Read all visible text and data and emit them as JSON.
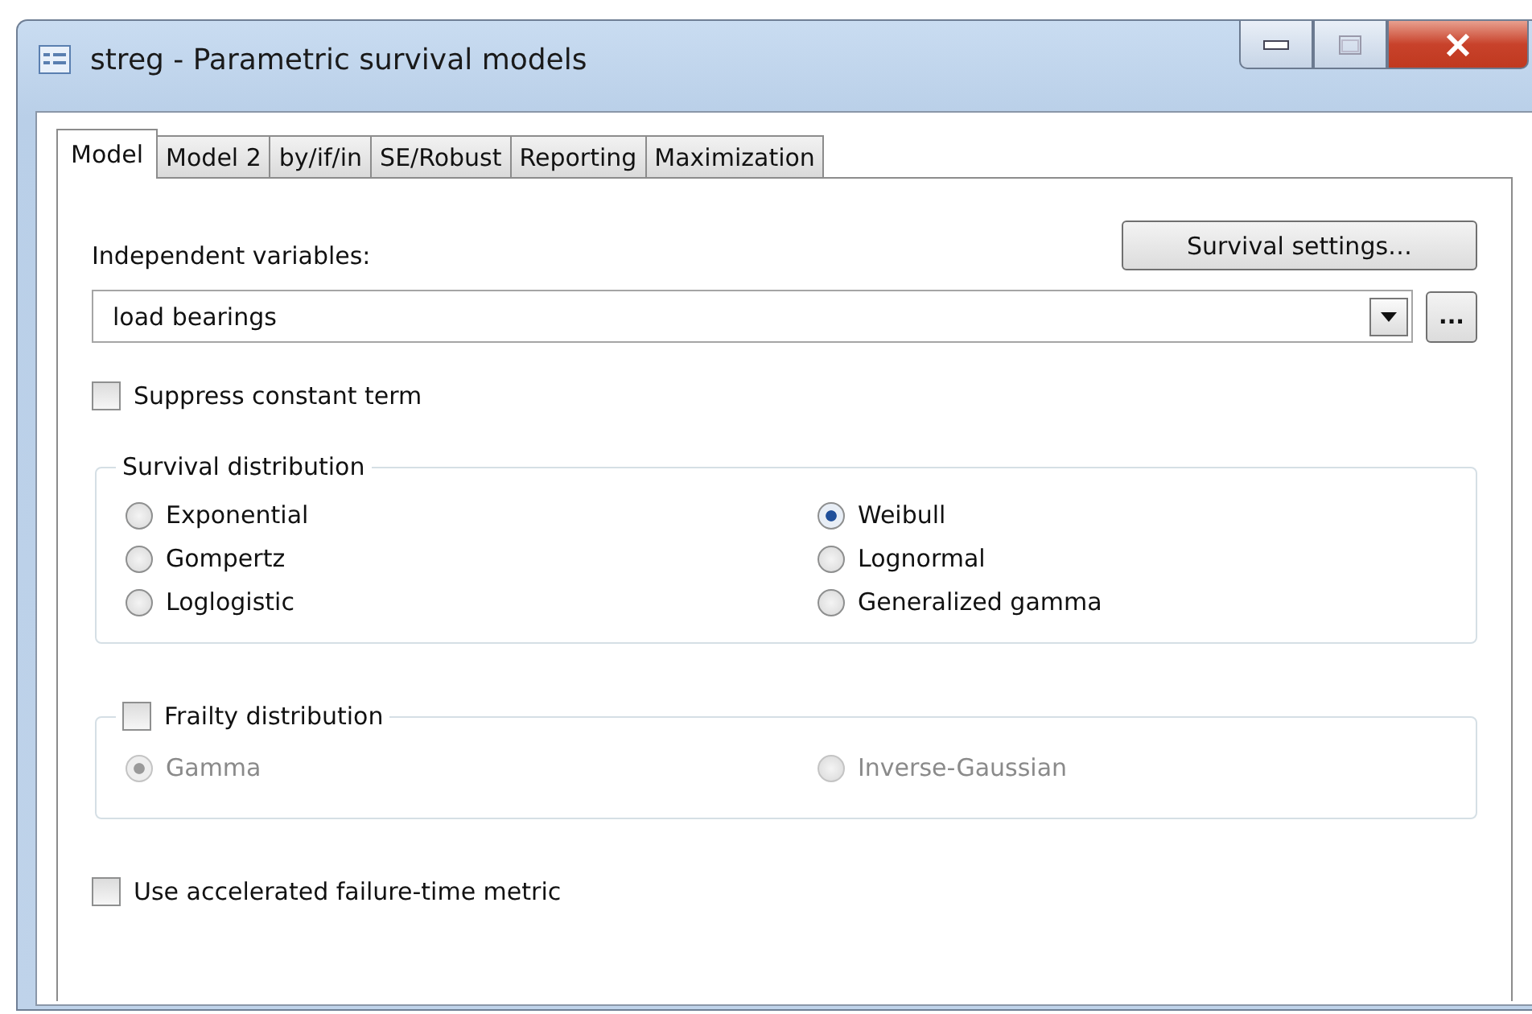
{
  "window": {
    "title": "streg - Parametric survival models"
  },
  "tabs": [
    {
      "label": "Model",
      "selected": true
    },
    {
      "label": "Model 2",
      "selected": false
    },
    {
      "label": "by/if/in",
      "selected": false
    },
    {
      "label": "SE/Robust",
      "selected": false
    },
    {
      "label": "Reporting",
      "selected": false
    },
    {
      "label": "Maximization",
      "selected": false
    }
  ],
  "model": {
    "independent_variables_label": "Independent variables:",
    "survival_settings_button": "Survival settings…",
    "variables_field": {
      "value": "load bearings"
    },
    "browse_button": "...",
    "suppress_constant": {
      "label": "Suppress constant term",
      "checked": false
    },
    "survival_distribution": {
      "title": "Survival distribution",
      "options": [
        {
          "label": "Exponential",
          "selected": false
        },
        {
          "label": "Weibull",
          "selected": true
        },
        {
          "label": "Gompertz",
          "selected": false
        },
        {
          "label": "Lognormal",
          "selected": false
        },
        {
          "label": "Loglogistic",
          "selected": false
        },
        {
          "label": "Generalized gamma",
          "selected": false
        }
      ]
    },
    "frailty_distribution": {
      "label": "Frailty distribution",
      "checked": false,
      "options": [
        {
          "label": "Gamma",
          "selected": true,
          "disabled": true
        },
        {
          "label": "Inverse-Gaussian",
          "selected": false,
          "disabled": true
        }
      ]
    },
    "accelerated_failure_time": {
      "label": "Use accelerated failure-time metric",
      "checked": false
    }
  }
}
